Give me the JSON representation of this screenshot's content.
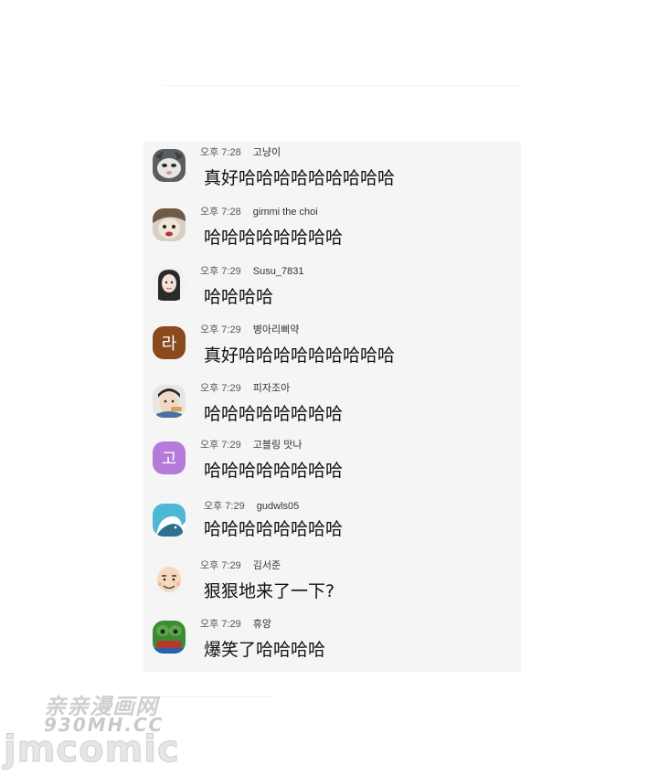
{
  "messages": [
    {
      "time": "오후 7:28",
      "user": "고냥이",
      "text": "真好哈哈哈哈哈哈哈哈哈",
      "avatar": "cat-photo-icon"
    },
    {
      "time": "오후 7:28",
      "user": "gimmi the choi",
      "text": "哈哈哈哈哈哈哈哈",
      "avatar": "cartoon-face-icon"
    },
    {
      "time": "오후 7:29",
      "user": "Susu_7831",
      "text": "哈哈哈哈",
      "avatar": "girl-portrait-icon"
    },
    {
      "time": "오후 7:29",
      "user": "병아리삐약",
      "text": "真好哈哈哈哈哈哈哈哈哈",
      "avatar": "letter-avatar",
      "letter": "라",
      "color": "#8a4a1e"
    },
    {
      "time": "오후 7:29",
      "user": "피자조아",
      "text": "哈哈哈哈哈哈哈哈",
      "avatar": "man-eating-icon"
    },
    {
      "time": "오후 7:29",
      "user": "고블링 맛나",
      "text": "哈哈哈哈哈哈哈哈",
      "avatar": "letter-avatar",
      "letter": "고",
      "color": "#b67ad8"
    },
    {
      "time": "오후 7:29",
      "user": "gudwls05",
      "text": "哈哈哈哈哈哈哈哈",
      "avatar": "whale-icon"
    },
    {
      "time": "오후 7:29",
      "user": "김서준",
      "text": "狠狠地来了一下?",
      "avatar": "bald-man-icon"
    },
    {
      "time": "오후 7:29",
      "user": "휴앙",
      "text": "爆笑了哈哈哈哈",
      "avatar": "frog-icon"
    }
  ],
  "watermark": {
    "line1": "亲亲漫画网",
    "line2": "930MH.CC",
    "line3": "jmcomic"
  }
}
